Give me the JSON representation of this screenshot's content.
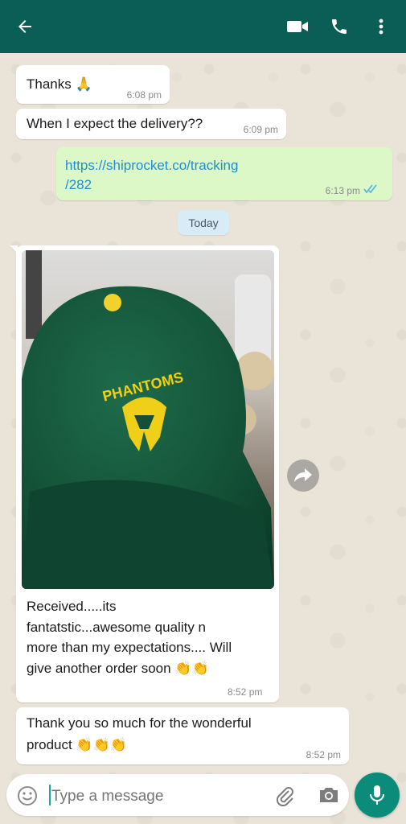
{
  "header": {
    "back_icon": "arrow-left-icon",
    "video_icon": "video-call-icon",
    "call_icon": "phone-icon",
    "menu_icon": "more-vert-icon",
    "color": "#075e54"
  },
  "messages": [
    {
      "direction": "in",
      "text": "Thanks 🙏",
      "time": "6:08 pm"
    },
    {
      "direction": "in",
      "text": "When I expect the delivery??",
      "time": "6:09 pm"
    },
    {
      "direction": "out",
      "text_line1": "https://shiprocket.co/tracking",
      "text_line2": "/282",
      "time": "6:13 pm",
      "status_icon": "double-check-icon"
    },
    {
      "direction": "in",
      "type": "image",
      "caption_lines": [
        "Received.....its",
        "fantatstic...awesome quality n",
        "more than my expectations.... Will",
        "give another order soon 👏👏"
      ],
      "time": "8:52 pm",
      "image_text": "PHANTOMS"
    },
    {
      "direction": "in",
      "text_line1": "Thank you so much for the wonderful",
      "text_line2": "product 👏👏👏",
      "time": "8:52 pm"
    }
  ],
  "date_chip": "Today",
  "input": {
    "placeholder": "Type a message",
    "emoji_icon": "emoji-icon",
    "attach_icon": "paperclip-icon",
    "camera_icon": "camera-icon",
    "mic_icon": "mic-icon"
  },
  "colors": {
    "incoming_bubble": "#ffffff",
    "outgoing_bubble": "#dcf8c6",
    "link": "#1d8fd1",
    "accent": "#0b8c7b"
  }
}
